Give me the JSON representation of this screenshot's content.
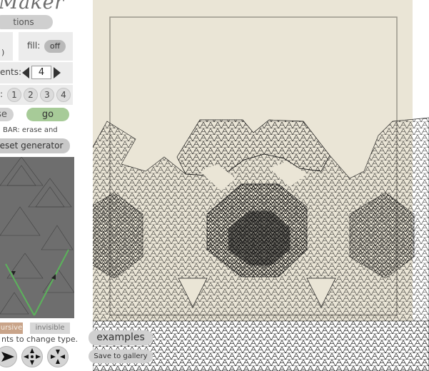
{
  "app": {
    "title": "Maker",
    "tab_label": "tions"
  },
  "controls": {
    "fill_label": "fill:",
    "fill_value": "off",
    "stub_value": ")",
    "segments_label": "ents:",
    "segments_value": "4",
    "type_label": ":",
    "type_options": [
      "1",
      "2",
      "3",
      "4"
    ],
    "erase_label": "se",
    "go_label": "go",
    "bar_hint": "BAR: erase and",
    "reset_label": "eset generator",
    "recursive_label": "ursive",
    "invisible_label": "invisible",
    "change_type_hint": "nts to change type."
  },
  "canvas": {
    "examples_label": "examples",
    "save_label": "Save to gallery"
  },
  "colors": {
    "paper": "#eae5d6",
    "go": "#a7cb98",
    "editor_bg": "#6e6e6e",
    "editor_line": "#5bb35b",
    "recursive_tag": "#c9a489",
    "invisible_tag": "#d7d7d7",
    "ink": "#111111"
  },
  "icons": [
    "arrow-left-icon",
    "arrow-right-icon",
    "play-arrow-icon",
    "move-in-icon",
    "move-out-icon"
  ]
}
